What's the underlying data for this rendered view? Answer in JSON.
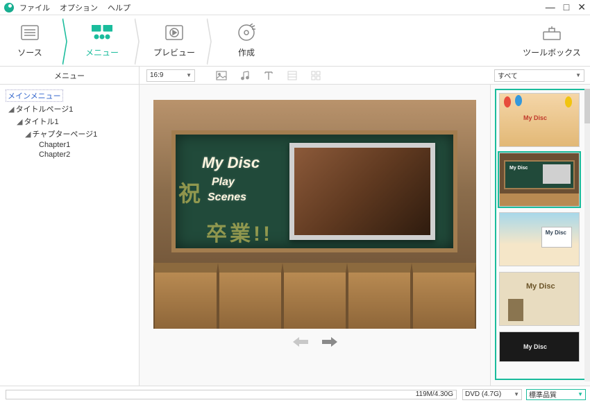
{
  "menubar": {
    "file": "ファイル",
    "option": "オプション",
    "help": "ヘルプ"
  },
  "steps": {
    "source": "ソース",
    "menu": "メニュー",
    "preview": "プレビュー",
    "create": "作成",
    "toolbox": "ツールボックス"
  },
  "subbar": {
    "tree_header": "メニュー",
    "aspect": "16:9",
    "filter": "すべて"
  },
  "tree": {
    "main": "メインメニュー",
    "title_page": "タイトルページ1",
    "title": "タイトル1",
    "chapter_page": "チャプターページ1",
    "chapter1": "Chapter1",
    "chapter2": "Chapter2"
  },
  "disc_menu": {
    "title": "My Disc",
    "play": "Play",
    "scenes": "Scenes"
  },
  "templates": {
    "t1": "My Disc",
    "t2": "My Disc",
    "t3": "My Disc",
    "t4": "My Disc",
    "t5": "My Disc"
  },
  "bottom": {
    "size": "119M/4.30G",
    "disc": "DVD (4.7G)",
    "quality": "標準品質"
  }
}
